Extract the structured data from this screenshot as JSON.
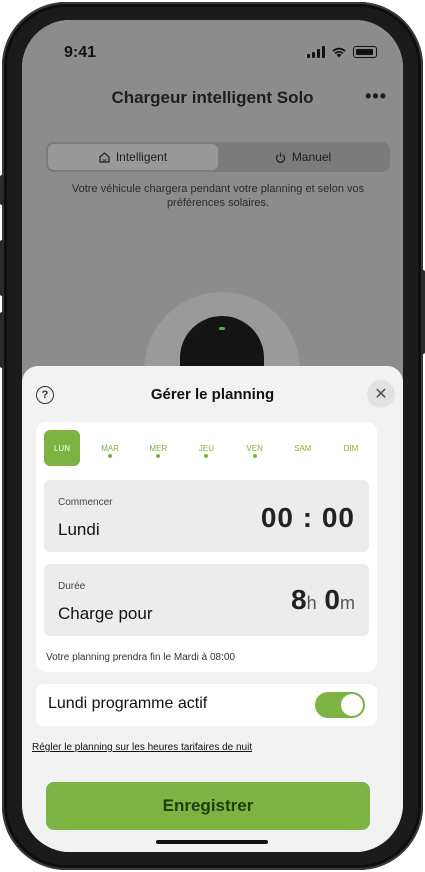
{
  "status_bar": {
    "time": "9:41"
  },
  "header": {
    "title": "Chargeur intelligent Solo",
    "more_symbol": "•••"
  },
  "mode_toggle": {
    "options": [
      {
        "label": "Intelligent",
        "icon": "home-icon",
        "selected": true
      },
      {
        "label": "Manuel",
        "icon": "power-icon",
        "selected": false
      }
    ]
  },
  "mode_description": "Votre véhicule chargera pendant votre planning et selon vos préférences solaires.",
  "sheet": {
    "help_symbol": "?",
    "title": "Gérer le planning",
    "close_symbol": "✕",
    "days": [
      {
        "label": "LUN",
        "selected": true,
        "scheduled": false
      },
      {
        "label": "MAR",
        "selected": false,
        "scheduled": true
      },
      {
        "label": "MER",
        "selected": false,
        "scheduled": true
      },
      {
        "label": "JEU",
        "selected": false,
        "scheduled": true
      },
      {
        "label": "VEN",
        "selected": false,
        "scheduled": true
      },
      {
        "label": "SAM",
        "selected": false,
        "scheduled": false
      },
      {
        "label": "DIM",
        "selected": false,
        "scheduled": false
      }
    ],
    "start": {
      "caption": "Commencer",
      "day": "Lundi",
      "time": "00 : 00"
    },
    "duration": {
      "caption": "Durée",
      "label": "Charge pour",
      "hours": "8",
      "hours_unit": "h",
      "minutes": "0",
      "minutes_unit": "m"
    },
    "end_note": "Votre planning prendra fin le Mardi à 08:00",
    "active": {
      "label": "Lundi programme actif",
      "on": true
    },
    "night_link": "Régler le planning sur les heures tarifaires de nuit",
    "save_label": "Enregistrer"
  },
  "colors": {
    "accent": "#7cb342",
    "overlay": "#8c8c8c",
    "sheet_bg": "#f2f2f2"
  }
}
